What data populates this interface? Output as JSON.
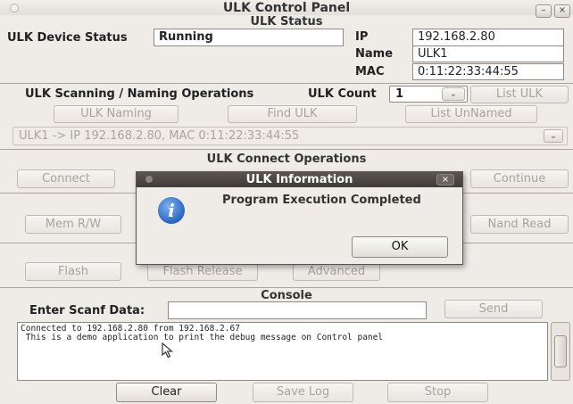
{
  "window": {
    "title": "ULK Control Panel",
    "minimize_glyph": "–",
    "close_glyph": "×"
  },
  "status": {
    "section_title": "ULK Status",
    "device_status_label": "ULK Device Status",
    "device_status_value": "Running",
    "ip_label": "IP",
    "ip_value": "192.168.2.80",
    "name_label": "Name",
    "name_value": "ULK1",
    "mac_label": "MAC",
    "mac_value": "0:11:22:33:44:55"
  },
  "scanning": {
    "section_title": "ULK Scanning / Naming Operations",
    "count_label": "ULK Count",
    "count_value": "1",
    "list_ulk_label": "List ULK",
    "naming_label": "ULK Naming",
    "find_label": "Find ULK",
    "list_unnamed_label": "List UnNamed",
    "device_select_value": "ULK1 -> IP 192.168.2.80, MAC 0:11:22:33:44:55"
  },
  "connect": {
    "section_title": "ULK Connect Operations",
    "connect_label": "Connect",
    "continue_label": "Continue"
  },
  "memory": {
    "mem_rw_label": "Mem R/W",
    "nand_read_label": "Nand Read"
  },
  "flash": {
    "flash_label": "Flash",
    "flash_release_label": "Flash Release",
    "advanced_label": "Advanced"
  },
  "console": {
    "section_title": "Console",
    "scanf_label": "Enter Scanf Data:",
    "scanf_value": "",
    "send_label": "Send",
    "output_lines": [
      "Connected to 192.168.2.80 from 192.168.2.67",
      " This is a demo application to print the debug message on Control panel"
    ],
    "clear_label": "Clear",
    "save_log_label": "Save Log",
    "stop_label": "Stop"
  },
  "dialog": {
    "title": "ULK Information",
    "message": "Program Execution Completed",
    "ok_label": "OK",
    "close_glyph": "×",
    "icon": "info-icon"
  }
}
